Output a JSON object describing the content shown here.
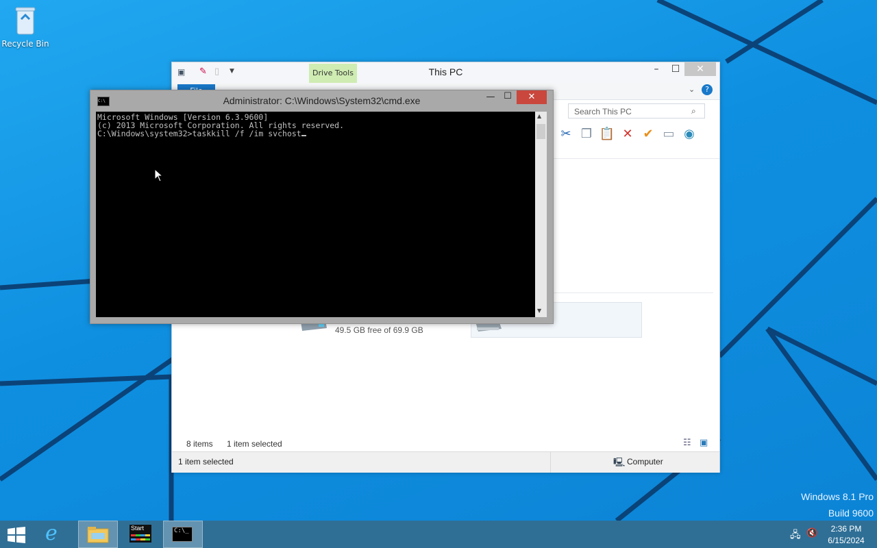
{
  "desktop": {
    "recycle_bin_label": "Recycle Bin",
    "watermark_line1": "Windows 8.1 Pro",
    "watermark_line2": "Build 9600"
  },
  "explorer": {
    "title": "This PC",
    "context_tab": "Drive Tools",
    "search_placeholder": "Search This PC",
    "drive_free": "49.5 GB free of 69.9 GB",
    "items_count": "8 items",
    "items_selected": "1 item selected",
    "status_selected": "1 item selected",
    "status_location": "Computer",
    "file_tab": "File"
  },
  "cmd": {
    "title": "Administrator: C:\\Windows\\System32\\cmd.exe",
    "lines": [
      "Microsoft Windows [Version 6.3.9600]",
      "(c) 2013 Microsoft Corporation. All rights reserved.",
      "",
      "C:\\Windows\\system32>taskkill /f /im svchost"
    ],
    "icon_text": "C:\\",
    "minimize": "—",
    "maximize": "☐",
    "close": "✕"
  },
  "taskbar": {
    "start_tile_label": "Start",
    "cmd_tile_label": "C:\\_",
    "time": "2:36 PM",
    "date": "6/15/2024"
  },
  "colors": {
    "taskbar": "#2f6f96",
    "desktop": "#1196e4",
    "close_red": "#c9473d",
    "drive_tools_green": "#cfecb2"
  }
}
